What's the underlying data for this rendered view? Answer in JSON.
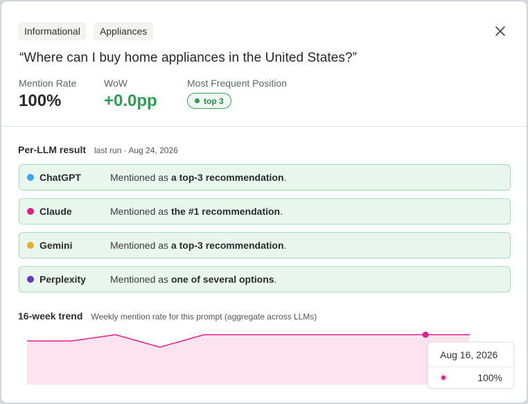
{
  "tags": [
    "Informational",
    "Appliances"
  ],
  "prompt_title": "“Where can I buy home appliances in the United States?”",
  "metrics": {
    "mention_rate": {
      "label": "Mention Rate",
      "value": "100%"
    },
    "wow": {
      "label": "WoW",
      "value": "+0.0pp"
    },
    "position": {
      "label": "Most Frequent Position",
      "value": "top 3"
    }
  },
  "per_llm": {
    "title": "Per-LLM result",
    "subtitle": "last run · Aug 24, 2026",
    "rows": [
      {
        "name": "ChatGPT",
        "color": "#3aa8f0",
        "prefix": "Mentioned as ",
        "emphasis": "a top-3 recommendation",
        "suffix": "."
      },
      {
        "name": "Claude",
        "color": "#e11d8c",
        "prefix": "Mentioned as ",
        "emphasis": "the #1 recommendation",
        "suffix": "."
      },
      {
        "name": "Gemini",
        "color": "#e3b22c",
        "prefix": "Mentioned as ",
        "emphasis": "a top-3 recommendation",
        "suffix": "."
      },
      {
        "name": "Perplexity",
        "color": "#6d33c8",
        "prefix": "Mentioned as ",
        "emphasis": "one of several options",
        "suffix": "."
      }
    ]
  },
  "trend": {
    "title": "16-week trend",
    "subtitle": "Weekly mention rate for this prompt (aggregate across LLMs)",
    "line_color": "#e11d8c",
    "fill_color": "#fbe3f0",
    "tooltip": {
      "date": "Aug 16, 2026",
      "value": "100%"
    }
  },
  "chart_data": {
    "type": "area",
    "series": [
      {
        "values": [
          90,
          90,
          100,
          80,
          100,
          100,
          100,
          100,
          100,
          100,
          100
        ]
      }
    ],
    "ylim": [
      60,
      100
    ],
    "highlight_index": 9
  }
}
